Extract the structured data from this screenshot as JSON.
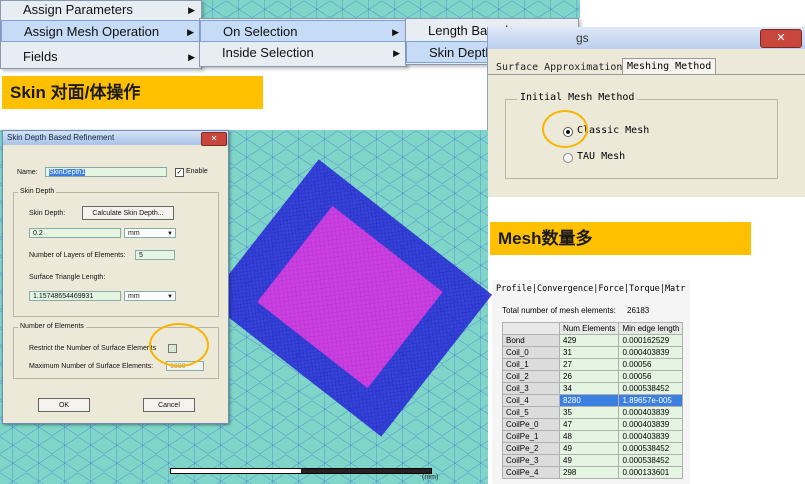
{
  "context_menu": {
    "level1": [
      {
        "label": "Assign Parameters",
        "underline_index": 7
      },
      {
        "label": "Assign Mesh Operation"
      },
      {
        "label": "Fields"
      }
    ],
    "level2": [
      {
        "label": "On Selection"
      },
      {
        "label": "Inside Selection"
      }
    ],
    "level3": [
      {
        "label": "Length Based..."
      },
      {
        "label": "Skin Depth Based..."
      }
    ]
  },
  "banners": {
    "skin": "Skin 对面/体操作",
    "mesh": "Mesh数量多"
  },
  "mesh_settings": {
    "title_fragment": "gs",
    "close_glyph": "✕",
    "tabs": [
      "Surface Approximation",
      "Meshing Method"
    ],
    "group_label": "Initial Mesh Method",
    "options": [
      {
        "label": "Classic Mesh",
        "selected": true
      },
      {
        "label": "TAU Mesh",
        "selected": false
      }
    ]
  },
  "skin_dialog": {
    "title": "Skin Depth Based Refinement",
    "close_glyph": "✕",
    "name_label": "Name:",
    "name_value": "SkinDepth1",
    "enable_label": "Enable",
    "enable_checked": true,
    "skin_group": "Skin Depth",
    "skin_depth_label": "Skin Depth:",
    "calc_button": "Calculate Skin Depth...",
    "skin_depth_value": "0.2",
    "skin_depth_unit": "mm",
    "layers_label": "Number of Layers of Elements:",
    "layers_value": "5",
    "tri_length_label": "Surface Triangle Length:",
    "tri_length_value": "1.15748654469931",
    "tri_length_unit": "mm",
    "elements_group": "Number of Elements",
    "restrict_label": "Restrict the Number of Surface Elements",
    "restrict_checked": false,
    "max_label": "Maximum Number of Surface Elements:",
    "max_value": "1000",
    "ok_label": "OK",
    "cancel_label": "Cancel"
  },
  "scale_bar": {
    "unit_label": "(mm)"
  },
  "mesh_stats": {
    "tabs": [
      "Profile",
      "Convergence",
      "Force",
      "Torque",
      "Matr"
    ],
    "total_label": "Total number of mesh elements:",
    "total_value": "26183",
    "columns": [
      "Num Elements",
      "Min edge length"
    ],
    "rows": [
      {
        "name": "Bond",
        "num": "429",
        "min": "0.000162529",
        "selected": false
      },
      {
        "name": "Coil_0",
        "num": "31",
        "min": "0.000403839",
        "selected": false
      },
      {
        "name": "Coil_1",
        "num": "27",
        "min": "0.00056",
        "selected": false
      },
      {
        "name": "Coil_2",
        "num": "26",
        "min": "0.00056",
        "selected": false
      },
      {
        "name": "Coil_3",
        "num": "34",
        "min": "0.000538452",
        "selected": false
      },
      {
        "name": "Coil_4",
        "num": "8280",
        "min": "1.89657e-005",
        "selected": true
      },
      {
        "name": "Coil_5",
        "num": "35",
        "min": "0.000403839",
        "selected": false
      },
      {
        "name": "CoilPe_0",
        "num": "47",
        "min": "0.000403839",
        "selected": false
      },
      {
        "name": "CoilPe_1",
        "num": "48",
        "min": "0.000403839",
        "selected": false
      },
      {
        "name": "CoilPe_2",
        "num": "49",
        "min": "0.000538452",
        "selected": false
      },
      {
        "name": "CoilPe_3",
        "num": "49",
        "min": "0.000538452",
        "selected": false
      },
      {
        "name": "CoilPe_4",
        "num": "298",
        "min": "0.000133601",
        "selected": false
      }
    ]
  }
}
